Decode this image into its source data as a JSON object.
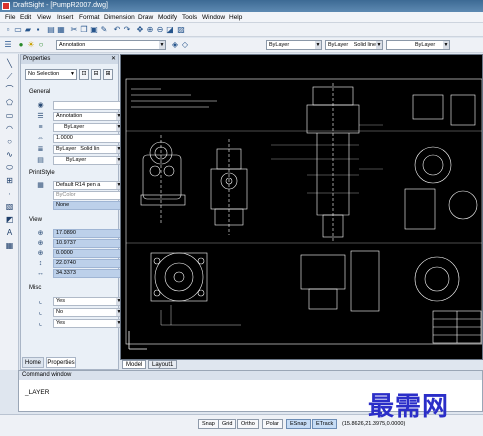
{
  "window": {
    "title": "DraftSight - [PumpR2007.dwg]"
  },
  "menu": [
    "File",
    "Edit",
    "View",
    "Insert",
    "Format",
    "Dimension",
    "Draw",
    "Modify",
    "Tools",
    "Window",
    "Help"
  ],
  "toolbar2": {
    "layer_value": "Annotation",
    "color_value": "ByLayer",
    "linetype_value": "ByLayer",
    "line_style": "Solid line",
    "lineweight_value": "ByLayer"
  },
  "properties": {
    "header": "Properties",
    "selection": "No Selection",
    "general_label": "General",
    "general": [
      "",
      "Annotation",
      "ByLayer",
      "1.0000",
      "ByLayer",
      "Solid lin",
      "ByLayer"
    ],
    "printstyle_label": "PrintStyle",
    "printstyle": [
      "Default R14 pen a",
      "ByColor",
      "None"
    ],
    "view_label": "View",
    "view": [
      "17.0890",
      "10.9737",
      "0.0000",
      "22.0740",
      "34.3373"
    ],
    "misc_label": "Misc",
    "misc": [
      "Yes",
      "No",
      "Yes"
    ]
  },
  "panel_tabs": [
    "Home",
    "Properties"
  ],
  "layout_tabs": [
    "Model",
    "Layout1"
  ],
  "command_window": {
    "title": "Command window",
    "text": "_LAYER"
  },
  "status_buttons": [
    "Snap",
    "Grid",
    "Ortho",
    "Polar",
    "ESnap",
    "ETrack"
  ],
  "status_active": [
    false,
    false,
    false,
    false,
    true,
    true
  ],
  "coordinates": "(15.8626,21.3975,0.0000)",
  "watermark": "最需网",
  "colors": {
    "canvas": "#000000",
    "linework": "#ffffff",
    "highlight": "#bcd0ea",
    "watermark": "#2b2ec8"
  }
}
